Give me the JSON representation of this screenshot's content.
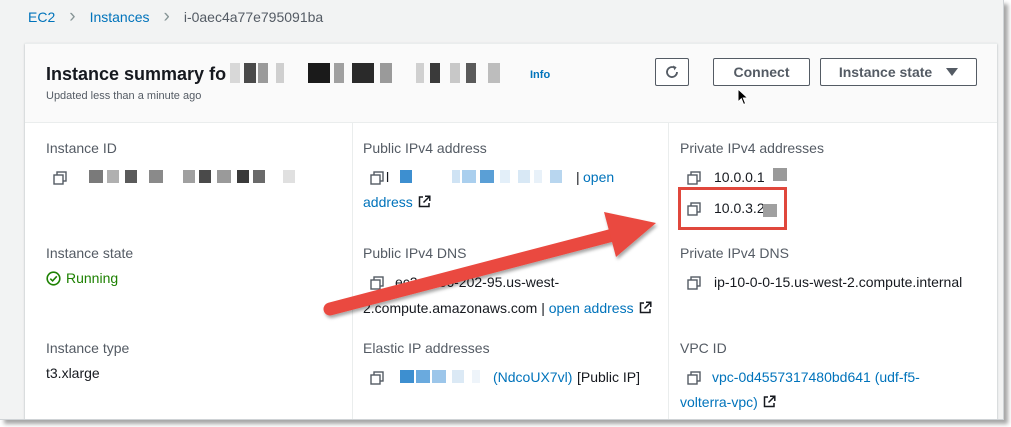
{
  "breadcrumb": {
    "items": [
      "EC2",
      "Instances"
    ],
    "current": "i-0aec4a77e795091ba"
  },
  "summary": {
    "title": "Instance summary fo",
    "info": "Info",
    "updated": "Updated less than a minute ago"
  },
  "buttons": {
    "connect": "Connect",
    "instance_state": "Instance state"
  },
  "icons": {
    "refresh": "refresh-icon",
    "copy": "copy-icon",
    "external": "external-link-icon",
    "status": "check-circle-icon",
    "dropdown": "caret-down-icon",
    "pointer": "mouse-pointer-icon"
  },
  "fields": {
    "instance_id": {
      "label": "Instance ID"
    },
    "public_ipv4": {
      "label": "Public IPv4 address",
      "prefix": "l",
      "sep": "|",
      "link": "open address"
    },
    "private_ipv4": {
      "label": "Private IPv4 addresses",
      "values": [
        "10.0.0.1",
        "10.0.3.2"
      ]
    },
    "instance_state": {
      "label": "Instance state",
      "value": "Running"
    },
    "public_dns": {
      "label": "Public IPv4 DNS",
      "line1": "ec2-  -236-202-95.us-west-",
      "line2": "2.compute.amazonaws.com",
      "sep": "|",
      "link": "open address"
    },
    "private_dns": {
      "label": "Private IPv4 DNS",
      "value": "ip-10-0-0-15.us-west-2.compute.internal"
    },
    "instance_type": {
      "label": "Instance type",
      "value": "t3.xlarge"
    },
    "elastic_ip": {
      "label": "Elastic IP addresses",
      "link": "(NdcoUX7vl)",
      "suffix": "[Public IP]"
    },
    "vpc_id": {
      "label": "VPC ID",
      "line1": "vpc-0d4557317480bd641 (udf-f5-",
      "line2": "volterra-vpc)"
    }
  },
  "colors": {
    "link": "#0073bb",
    "running": "#1d8102",
    "annotation": "#e0473c"
  }
}
